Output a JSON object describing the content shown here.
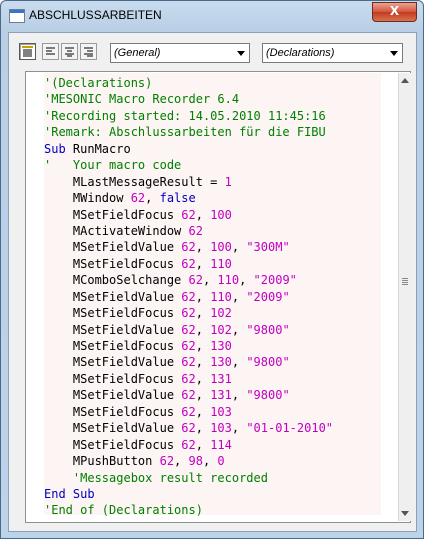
{
  "window": {
    "title": "ABSCHLUSSARBEITEN",
    "close_label": "X"
  },
  "toolbar": {
    "object_combo": "(General)",
    "procedure_combo": "(Declarations)"
  },
  "code_lines": [
    [
      {
        "t": "'(Declarations)",
        "k": "comment"
      }
    ],
    [
      {
        "t": "'MESONIC Macro Recorder 6.4",
        "k": "comment"
      }
    ],
    [
      {
        "t": "'Recording started: 14.05.2010 11:45:16",
        "k": "comment"
      }
    ],
    [
      {
        "t": "'Remark: Abschlussarbeiten für die FIBU",
        "k": "comment"
      }
    ],
    [
      {
        "t": "Sub",
        "k": "keyword"
      },
      {
        "t": " RunMacro",
        "k": "plain"
      }
    ],
    [
      {
        "t": "'   Your macro code",
        "k": "comment"
      }
    ],
    [
      {
        "t": "    MLastMessageResult = ",
        "k": "plain"
      },
      {
        "t": "1",
        "k": "number"
      }
    ],
    [
      {
        "t": "    MWindow ",
        "k": "plain"
      },
      {
        "t": "62",
        "k": "number"
      },
      {
        "t": ", ",
        "k": "plain"
      },
      {
        "t": "false",
        "k": "keyword"
      }
    ],
    [
      {
        "t": "    MSetFieldFocus ",
        "k": "plain"
      },
      {
        "t": "62",
        "k": "number"
      },
      {
        "t": ", ",
        "k": "plain"
      },
      {
        "t": "100",
        "k": "number"
      }
    ],
    [
      {
        "t": "    MActivateWindow ",
        "k": "plain"
      },
      {
        "t": "62",
        "k": "number"
      }
    ],
    [
      {
        "t": "    MSetFieldValue ",
        "k": "plain"
      },
      {
        "t": "62",
        "k": "number"
      },
      {
        "t": ", ",
        "k": "plain"
      },
      {
        "t": "100",
        "k": "number"
      },
      {
        "t": ", ",
        "k": "plain"
      },
      {
        "t": "\"300M\"",
        "k": "string"
      }
    ],
    [
      {
        "t": "    MSetFieldFocus ",
        "k": "plain"
      },
      {
        "t": "62",
        "k": "number"
      },
      {
        "t": ", ",
        "k": "plain"
      },
      {
        "t": "110",
        "k": "number"
      }
    ],
    [
      {
        "t": "    MComboSelchange ",
        "k": "plain"
      },
      {
        "t": "62",
        "k": "number"
      },
      {
        "t": ", ",
        "k": "plain"
      },
      {
        "t": "110",
        "k": "number"
      },
      {
        "t": ", ",
        "k": "plain"
      },
      {
        "t": "\"2009\"",
        "k": "string"
      }
    ],
    [
      {
        "t": "    MSetFieldValue ",
        "k": "plain"
      },
      {
        "t": "62",
        "k": "number"
      },
      {
        "t": ", ",
        "k": "plain"
      },
      {
        "t": "110",
        "k": "number"
      },
      {
        "t": ", ",
        "k": "plain"
      },
      {
        "t": "\"2009\"",
        "k": "string"
      }
    ],
    [
      {
        "t": "    MSetFieldFocus ",
        "k": "plain"
      },
      {
        "t": "62",
        "k": "number"
      },
      {
        "t": ", ",
        "k": "plain"
      },
      {
        "t": "102",
        "k": "number"
      }
    ],
    [
      {
        "t": "    MSetFieldValue ",
        "k": "plain"
      },
      {
        "t": "62",
        "k": "number"
      },
      {
        "t": ", ",
        "k": "plain"
      },
      {
        "t": "102",
        "k": "number"
      },
      {
        "t": ", ",
        "k": "plain"
      },
      {
        "t": "\"9800\"",
        "k": "string"
      }
    ],
    [
      {
        "t": "    MSetFieldFocus ",
        "k": "plain"
      },
      {
        "t": "62",
        "k": "number"
      },
      {
        "t": ", ",
        "k": "plain"
      },
      {
        "t": "130",
        "k": "number"
      }
    ],
    [
      {
        "t": "    MSetFieldValue ",
        "k": "plain"
      },
      {
        "t": "62",
        "k": "number"
      },
      {
        "t": ", ",
        "k": "plain"
      },
      {
        "t": "130",
        "k": "number"
      },
      {
        "t": ", ",
        "k": "plain"
      },
      {
        "t": "\"9800\"",
        "k": "string"
      }
    ],
    [
      {
        "t": "    MSetFieldFocus ",
        "k": "plain"
      },
      {
        "t": "62",
        "k": "number"
      },
      {
        "t": ", ",
        "k": "plain"
      },
      {
        "t": "131",
        "k": "number"
      }
    ],
    [
      {
        "t": "    MSetFieldValue ",
        "k": "plain"
      },
      {
        "t": "62",
        "k": "number"
      },
      {
        "t": ", ",
        "k": "plain"
      },
      {
        "t": "131",
        "k": "number"
      },
      {
        "t": ", ",
        "k": "plain"
      },
      {
        "t": "\"9800\"",
        "k": "string"
      }
    ],
    [
      {
        "t": "    MSetFieldFocus ",
        "k": "plain"
      },
      {
        "t": "62",
        "k": "number"
      },
      {
        "t": ", ",
        "k": "plain"
      },
      {
        "t": "103",
        "k": "number"
      }
    ],
    [
      {
        "t": "    MSetFieldValue ",
        "k": "plain"
      },
      {
        "t": "62",
        "k": "number"
      },
      {
        "t": ", ",
        "k": "plain"
      },
      {
        "t": "103",
        "k": "number"
      },
      {
        "t": ", ",
        "k": "plain"
      },
      {
        "t": "\"01-01-2010\"",
        "k": "string"
      }
    ],
    [
      {
        "t": "    MSetFieldFocus ",
        "k": "plain"
      },
      {
        "t": "62",
        "k": "number"
      },
      {
        "t": ", ",
        "k": "plain"
      },
      {
        "t": "114",
        "k": "number"
      }
    ],
    [
      {
        "t": "    MPushButton ",
        "k": "plain"
      },
      {
        "t": "62",
        "k": "number"
      },
      {
        "t": ", ",
        "k": "plain"
      },
      {
        "t": "98",
        "k": "number"
      },
      {
        "t": ", ",
        "k": "plain"
      },
      {
        "t": "0",
        "k": "number"
      }
    ],
    [
      {
        "t": "    'Messagebox result recorded",
        "k": "comment"
      }
    ],
    [
      {
        "t": "End Sub",
        "k": "keyword"
      }
    ],
    [
      {
        "t": "'End of (Declarations)",
        "k": "comment"
      }
    ]
  ],
  "colors": {
    "comment": "#008000",
    "keyword": "#0000c0",
    "literal": "#c000c0",
    "editor_background": "#fdf4f4"
  }
}
